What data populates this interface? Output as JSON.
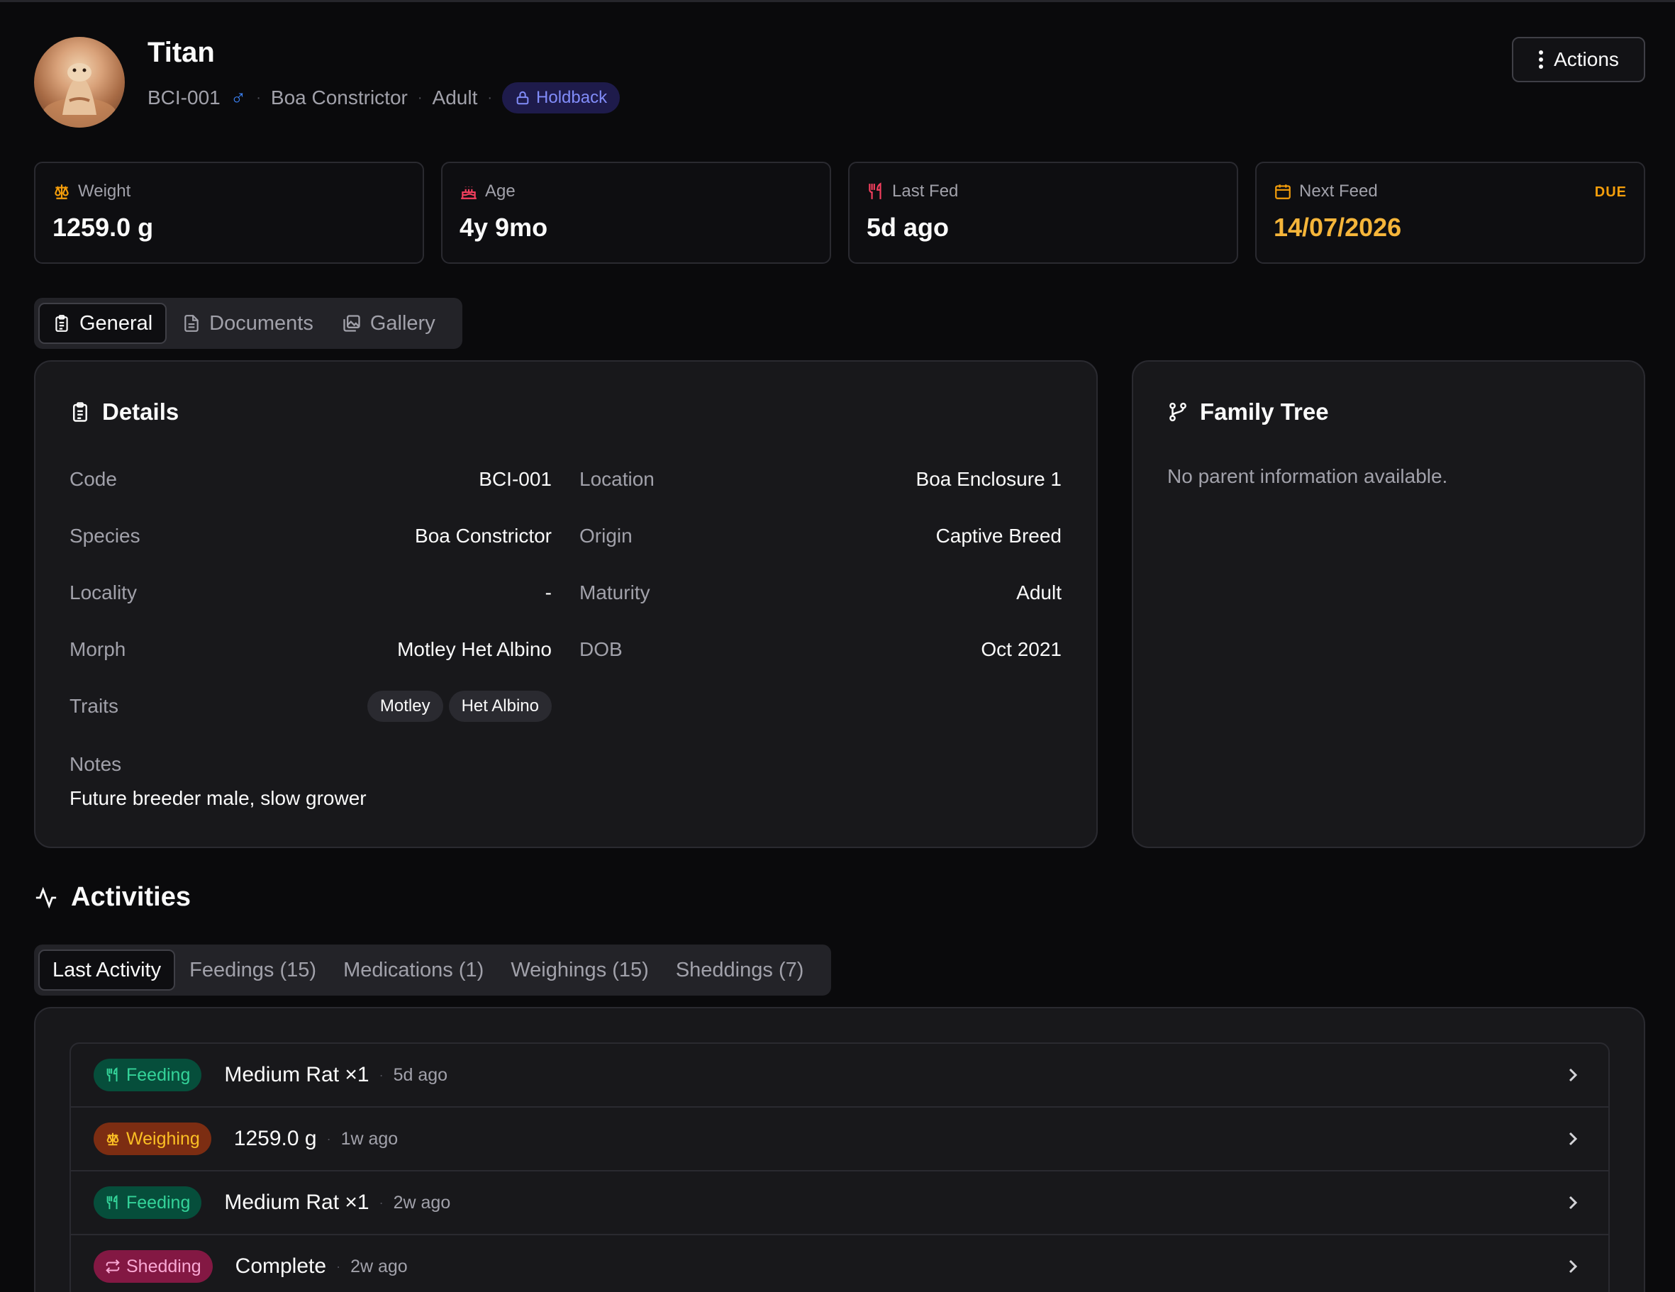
{
  "animal": {
    "name": "Titan",
    "code": "BCI-001",
    "sex_symbol": "♂",
    "species": "Boa Constrictor",
    "maturity": "Adult",
    "status_badge": "Holdback"
  },
  "header": {
    "actions_label": "Actions"
  },
  "stats": {
    "weight": {
      "label": "Weight",
      "value": "1259.0 g"
    },
    "age": {
      "label": "Age",
      "value": "4y 9mo"
    },
    "last_fed": {
      "label": "Last Fed",
      "value": "5d ago"
    },
    "next_feed": {
      "label": "Next Feed",
      "value": "14/07/2026",
      "badge": "DUE"
    }
  },
  "tabs": [
    "General",
    "Documents",
    "Gallery"
  ],
  "details": {
    "title": "Details",
    "left": [
      {
        "k": "Code",
        "v": "BCI-001"
      },
      {
        "k": "Species",
        "v": "Boa Constrictor"
      },
      {
        "k": "Locality",
        "v": "-"
      },
      {
        "k": "Morph",
        "v": "Motley Het Albino"
      },
      {
        "k": "Traits",
        "v": ""
      }
    ],
    "right": [
      {
        "k": "Location",
        "v": "Boa Enclosure 1"
      },
      {
        "k": "Origin",
        "v": "Captive Breed"
      },
      {
        "k": "Maturity",
        "v": "Adult"
      },
      {
        "k": "DOB",
        "v": "Oct 2021"
      }
    ],
    "traits": [
      "Motley",
      "Het Albino"
    ],
    "notes_label": "Notes",
    "notes": "Future breeder male, slow grower"
  },
  "family_tree": {
    "title": "Family Tree",
    "empty": "No parent information available."
  },
  "activities": {
    "title": "Activities",
    "tabs": [
      "Last Activity",
      "Feedings (15)",
      "Medications (1)",
      "Weighings (15)",
      "Sheddings (7)"
    ],
    "items": [
      {
        "type": "Feeding",
        "main": "Medium Rat ×1",
        "ago": "5d ago"
      },
      {
        "type": "Weighing",
        "main": "1259.0 g",
        "ago": "1w ago"
      },
      {
        "type": "Feeding",
        "main": "Medium Rat ×1",
        "ago": "2w ago"
      },
      {
        "type": "Shedding",
        "main": "Complete",
        "ago": "2w ago"
      }
    ]
  },
  "colors": {
    "accent_due": "#f59e0b",
    "male": "#3b82f6",
    "holdback": "#818cf8"
  }
}
